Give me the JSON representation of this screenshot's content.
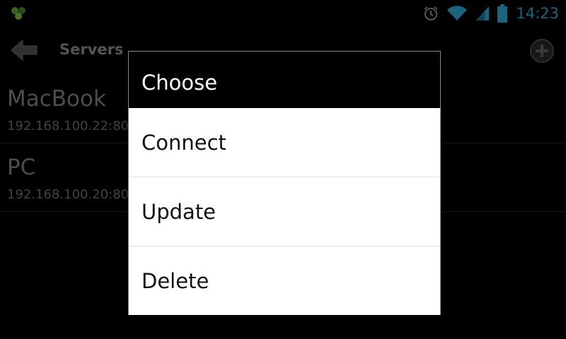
{
  "status_bar": {
    "time": "14:23",
    "accent_color": "#33b5e5",
    "icons": [
      "notification-icon",
      "alarm-icon",
      "wifi-icon",
      "signal-icon",
      "battery-icon"
    ]
  },
  "action_bar": {
    "title": "Servers",
    "back_icon": "back-arrow-icon",
    "add_icon": "add-icon"
  },
  "servers": [
    {
      "name": "MacBook",
      "address": "192.168.100.22:80"
    },
    {
      "name": "PC",
      "address": "192.168.100.20:80"
    }
  ],
  "dialog": {
    "title": "Choose",
    "options": [
      "Connect",
      "Update",
      "Delete"
    ]
  }
}
